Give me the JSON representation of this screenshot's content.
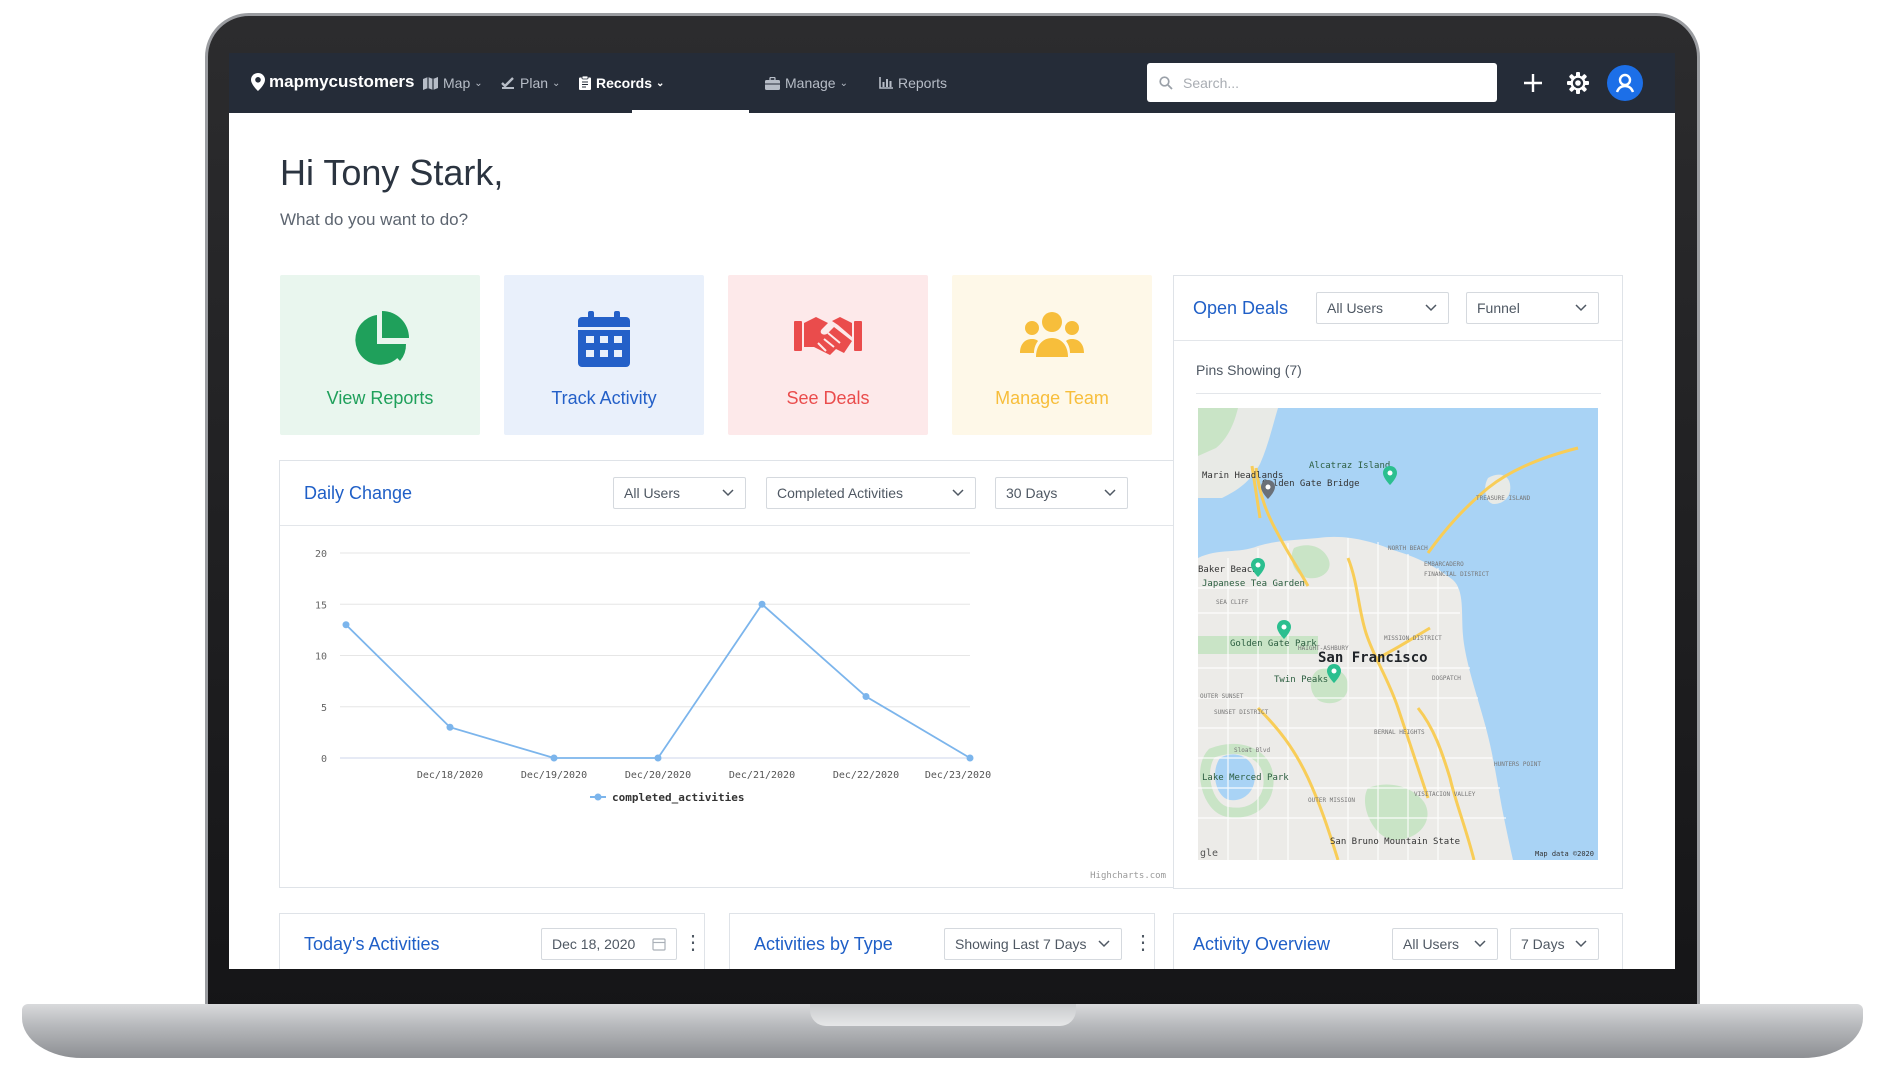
{
  "nav": {
    "brand": "mapmycustomers",
    "items": [
      {
        "label": "Map",
        "has_menu": true
      },
      {
        "label": "Plan",
        "has_menu": true
      },
      {
        "label": "Records",
        "has_menu": true,
        "active": true
      },
      {
        "label": "Manage",
        "has_menu": true
      },
      {
        "label": "Reports",
        "has_menu": false
      }
    ],
    "search_placeholder": "Search..."
  },
  "greeting": {
    "title": "Hi Tony Stark,",
    "subtitle": "What do you want to do?"
  },
  "actions": [
    {
      "label": "View Reports",
      "icon": "pie-chart-icon",
      "color": "#1fa05b",
      "bg": "#e9f6ee"
    },
    {
      "label": "Track Activity",
      "icon": "calendar-icon",
      "color": "#2460c8",
      "bg": "#e9f0fb"
    },
    {
      "label": "See Deals",
      "icon": "handshake-icon",
      "color": "#ea4c4c",
      "bg": "#fde9ea"
    },
    {
      "label": "Manage Team",
      "icon": "team-icon",
      "color": "#f7be3b",
      "bg": "#fef8e8"
    }
  ],
  "daily_change": {
    "title": "Daily Change",
    "filters": {
      "users": "All Users",
      "metric": "Completed Activities",
      "range": "30 Days"
    },
    "credit": "Highcharts.com"
  },
  "chart_data": {
    "type": "line",
    "x": [
      "Dec/17/2020",
      "Dec/18/2020",
      "Dec/19/2020",
      "Dec/20/2020",
      "Dec/21/2020",
      "Dec/22/2020",
      "Dec/23/2020"
    ],
    "tick_labels": [
      "Dec/18/2020",
      "Dec/19/2020",
      "Dec/20/2020",
      "Dec/21/2020",
      "Dec/22/2020",
      "Dec/23/2020"
    ],
    "series": [
      {
        "name": "completed_activities",
        "values": [
          13,
          3,
          0,
          0,
          15,
          6,
          0
        ],
        "color": "#7cb5ec"
      }
    ],
    "ylim": [
      0,
      20
    ],
    "yticks": [
      0,
      5,
      10,
      15,
      20
    ],
    "grid": true,
    "legend": "bottom-center"
  },
  "open_deals": {
    "title": "Open Deals",
    "filters": {
      "users": "All Users",
      "view": "Funnel"
    },
    "pins": "Pins Showing (7)",
    "map": {
      "city": "San Francisco",
      "labels": [
        "Alcatraz Island",
        "Golden Gate Bridge",
        "Marin Headlands",
        "Japanese Tea Garden",
        "Golden Gate Park",
        "Twin Peaks",
        "NORTH BEACH",
        "EMBARCADERO",
        "FINANCIAL DISTRICT",
        "HAIGHT-ASHBURY",
        "MISSION DISTRICT",
        "DOGPATCH",
        "OUTER SUNSET",
        "SUNSET DISTRICT",
        "BERNAL HEIGHTS",
        "HUNTERS POINT",
        "Lake Merced Park",
        "OUTER MISSION",
        "VISITACION VALLEY",
        "San Bruno Mountain State",
        "TREASURE ISLAND",
        "SEA CLIFF",
        "Sloat Blvd",
        "Baker Beach"
      ],
      "attribution": "Map data ©2020",
      "google_mark": "gle"
    }
  },
  "bottom_cards": {
    "today": {
      "title": "Today's Activities",
      "date": "Dec 18, 2020"
    },
    "by_type": {
      "title": "Activities by Type",
      "range": "Showing Last 7 Days"
    },
    "overview": {
      "title": "Activity Overview",
      "users": "All Users",
      "range": "7 Days"
    }
  }
}
